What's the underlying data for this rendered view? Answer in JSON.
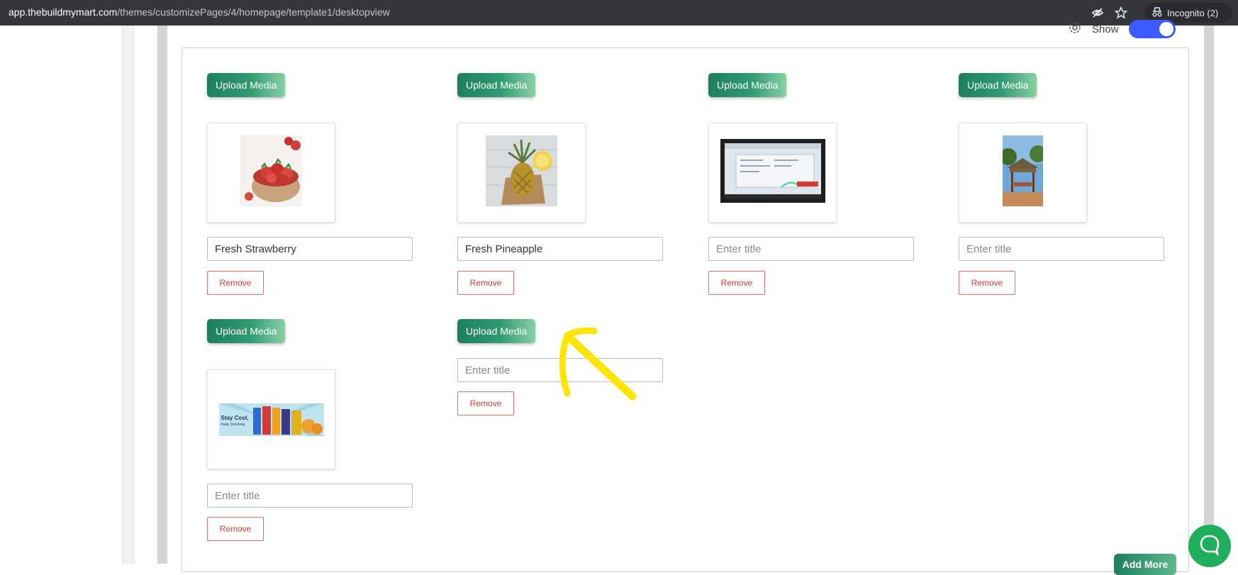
{
  "browser": {
    "url_host": "app.thebuildmymart.com",
    "url_path": "/themes/customizePages/4/homepage/template1/desktopview",
    "incognito_label": "Incognito (2)"
  },
  "header": {
    "show_label": "Show",
    "show_enabled": true
  },
  "items": [
    {
      "upload_label": "Upload Media",
      "title_value": "Fresh Strawberry",
      "placeholder": "Enter title",
      "remove_label": "Remove",
      "image": "strawberry-bowl-image"
    },
    {
      "upload_label": "Upload Media",
      "title_value": "Fresh Pineapple",
      "placeholder": "Enter title",
      "remove_label": "Remove",
      "image": "pineapple-image"
    },
    {
      "upload_label": "Upload Media",
      "title_value": "",
      "placeholder": "Enter title",
      "remove_label": "Remove",
      "image": "monitor-screenshot-image"
    },
    {
      "upload_label": "Upload Media",
      "title_value": "",
      "placeholder": "Enter title",
      "remove_label": "Remove",
      "image": "gazebo-photo-image"
    },
    {
      "upload_label": "Upload Media",
      "title_value": "",
      "placeholder": "Enter title",
      "remove_label": "Remove",
      "image": "snacks-banner-image",
      "banner_text_1": "Stay Cool,",
      "banner_text_2": "Keep Snacking"
    },
    {
      "upload_label": "Upload Media",
      "title_value": "",
      "placeholder": "Enter title",
      "remove_label": "Remove",
      "image": null
    }
  ],
  "footer": {
    "add_more_label": "Add More"
  },
  "colors": {
    "accent_green": "#1d7f60",
    "toggle_blue": "#3d5afe",
    "remove_red": "#d33b3b",
    "annotation_yellow": "#ffe500"
  }
}
